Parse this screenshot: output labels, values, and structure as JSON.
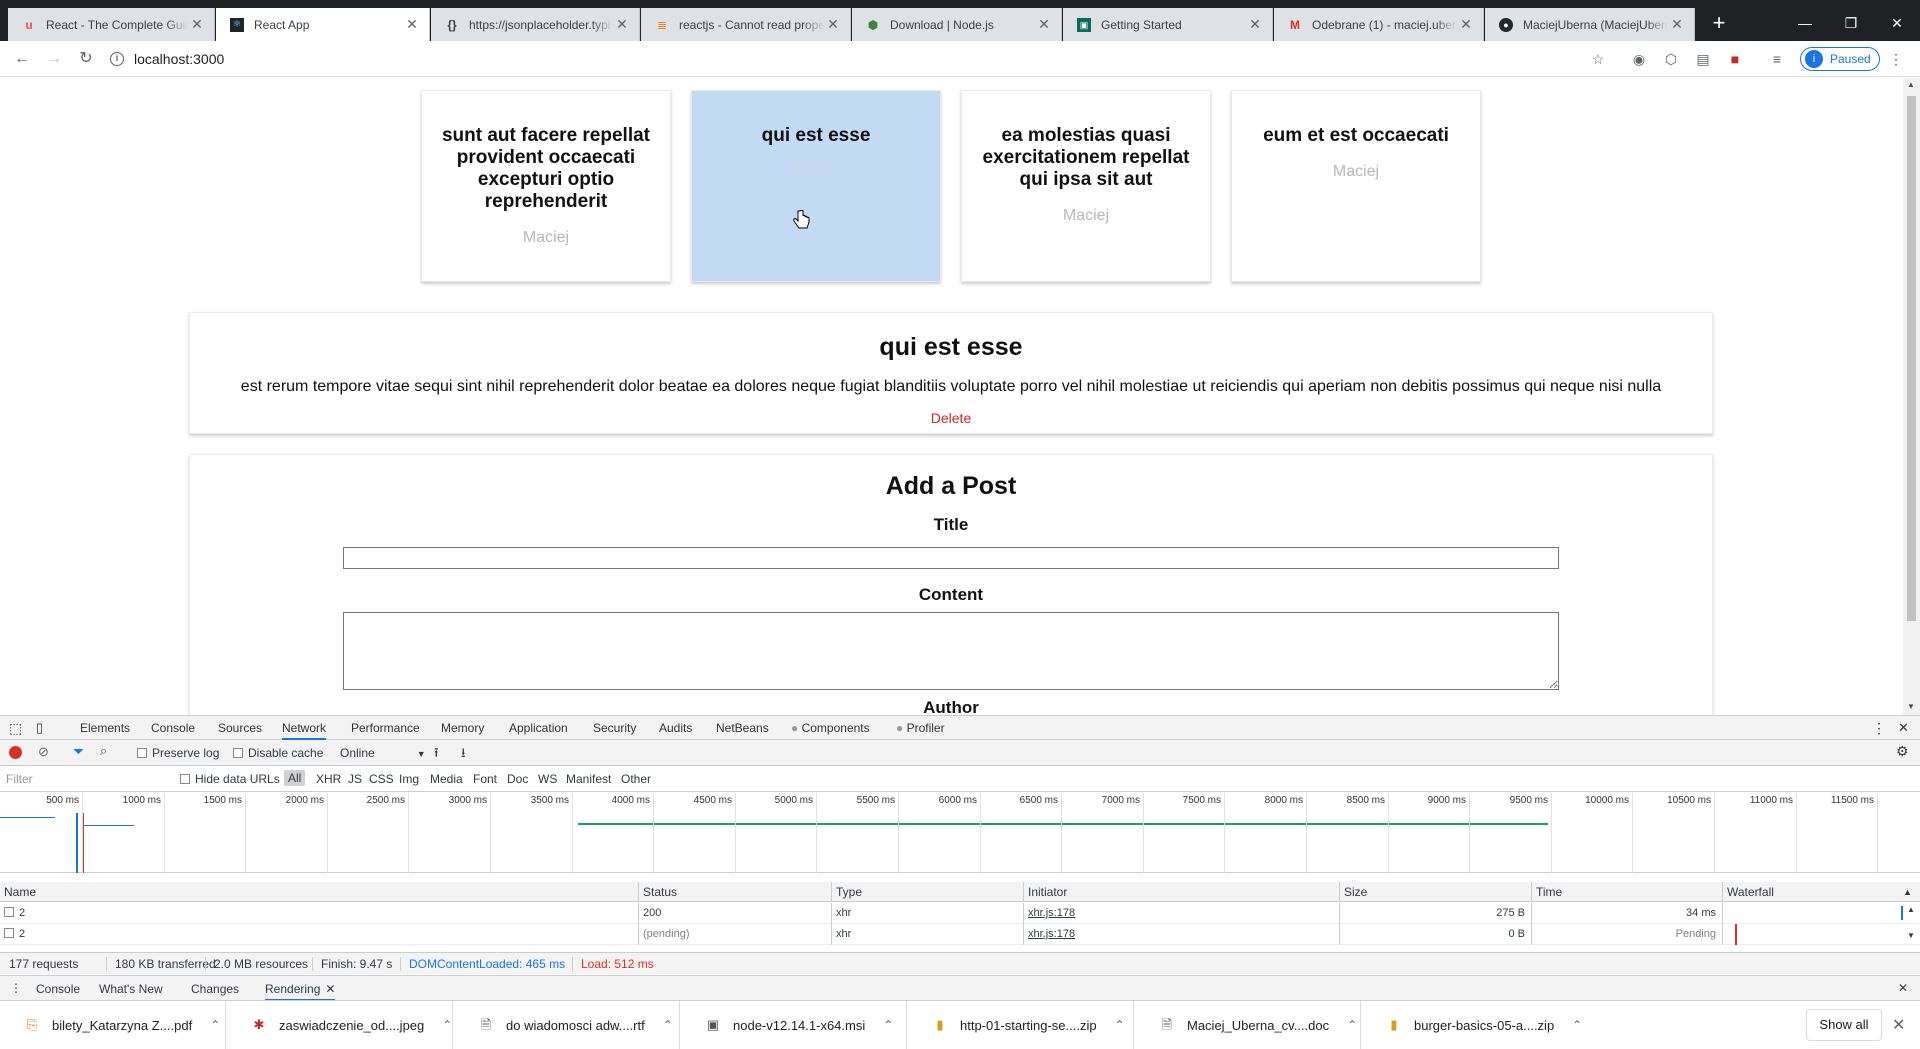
{
  "browser": {
    "tabs": [
      {
        "label": "React - The Complete Guid",
        "icon": "udemy-icon"
      },
      {
        "label": "React App",
        "icon": "react-icon"
      },
      {
        "label": "https://jsonplaceholder.typi",
        "icon": "jsonplaceholder-icon"
      },
      {
        "label": "reactjs - Cannot read prope",
        "icon": "stackoverflow-icon"
      },
      {
        "label": "Download | Node.js",
        "icon": "nodejs-icon"
      },
      {
        "label": "Getting Started",
        "icon": "getting-started-icon"
      },
      {
        "label": "Odebrane (1) - maciej.uber",
        "icon": "gmail-icon"
      },
      {
        "label": "MaciejUberna (MaciejUbern",
        "icon": "github-icon"
      }
    ],
    "url": "localhost:3000",
    "profile_status": "Paused",
    "profile_initial": "i"
  },
  "page": {
    "posts": [
      {
        "title": "sunt aut facere repellat provident occaecati excepturi optio reprehenderit",
        "author": "Maciej"
      },
      {
        "title": "qui est esse",
        "author": "Maciej"
      },
      {
        "title": "ea molestias quasi exercitationem repellat qui ipsa sit aut",
        "author": "Maciej"
      },
      {
        "title": "eum et est occaecati",
        "author": "Maciej"
      }
    ],
    "full_post": {
      "title": "qui est esse",
      "body": "est rerum tempore vitae sequi sint nihil reprehenderit dolor beatae ea dolores neque fugiat blanditiis voluptate porro vel nihil molestiae ut reiciendis qui aperiam non debitis possimus qui neque nisi nulla",
      "delete_label": "Delete"
    },
    "new_post": {
      "heading": "Add a Post",
      "title_label": "Title",
      "title_value": "",
      "content_label": "Content",
      "content_value": "",
      "author_label": "Author"
    }
  },
  "devtools": {
    "tabs": [
      "Elements",
      "Console",
      "Sources",
      "Network",
      "Performance",
      "Memory",
      "Application",
      "Security",
      "Audits",
      "NetBeans",
      "Components",
      "Profiler"
    ],
    "active_tab": "Network",
    "toolbar": {
      "preserve_log": "Preserve log",
      "disable_cache": "Disable cache",
      "throttle": "Online"
    },
    "filter": {
      "placeholder": "Filter",
      "hide_data_urls": "Hide data URLs",
      "types": [
        "All",
        "XHR",
        "JS",
        "CSS",
        "Img",
        "Media",
        "Font",
        "Doc",
        "WS",
        "Manifest",
        "Other"
      ]
    },
    "timeline_ticks": [
      "500 ms",
      "1000 ms",
      "1500 ms",
      "2000 ms",
      "2500 ms",
      "3000 ms",
      "3500 ms",
      "4000 ms",
      "4500 ms",
      "5000 ms",
      "5500 ms",
      "6000 ms",
      "6500 ms",
      "7000 ms",
      "7500 ms",
      "8000 ms",
      "8500 ms",
      "9000 ms",
      "9500 ms",
      "10000 ms",
      "10500 ms",
      "11000 ms",
      "11500 ms"
    ],
    "columns": [
      "Name",
      "Status",
      "Type",
      "Initiator",
      "Size",
      "Time",
      "Waterfall"
    ],
    "rows": [
      {
        "name": "2",
        "status": "200",
        "type": "xhr",
        "initiator": "xhr.js:178",
        "size": "275 B",
        "time": "34 ms"
      },
      {
        "name": "2",
        "status": "(pending)",
        "type": "xhr",
        "initiator": "xhr.js:178",
        "size": "0 B",
        "time": "Pending"
      }
    ],
    "summary": {
      "requests": "177 requests",
      "transferred": "180 KB transferred",
      "resources": "2.0 MB resources",
      "finish": "Finish: 9.47 s",
      "dom_content_loaded": "DOMContentLoaded: 465 ms",
      "load": "Load: 512 ms"
    },
    "drawer_tabs": [
      "Console",
      "What's New",
      "Changes",
      "Rendering"
    ],
    "drawer_active": "Rendering"
  },
  "downloads": {
    "items": [
      {
        "name": "bilety_Katarzyna Z....pdf",
        "icon": "pdf-icon"
      },
      {
        "name": "zaswiadczenie_od....jpeg",
        "icon": "image-icon"
      },
      {
        "name": "do wiadomosci adw....rtf",
        "icon": "doc-icon"
      },
      {
        "name": "node-v12.14.1-x64.msi",
        "icon": "installer-icon"
      },
      {
        "name": "http-01-starting-se....zip",
        "icon": "zip-icon"
      },
      {
        "name": "Maciej_Uberna_cv....doc",
        "icon": "doc-icon"
      },
      {
        "name": "burger-basics-05-a....zip",
        "icon": "zip-icon"
      }
    ],
    "show_all": "Show all"
  }
}
